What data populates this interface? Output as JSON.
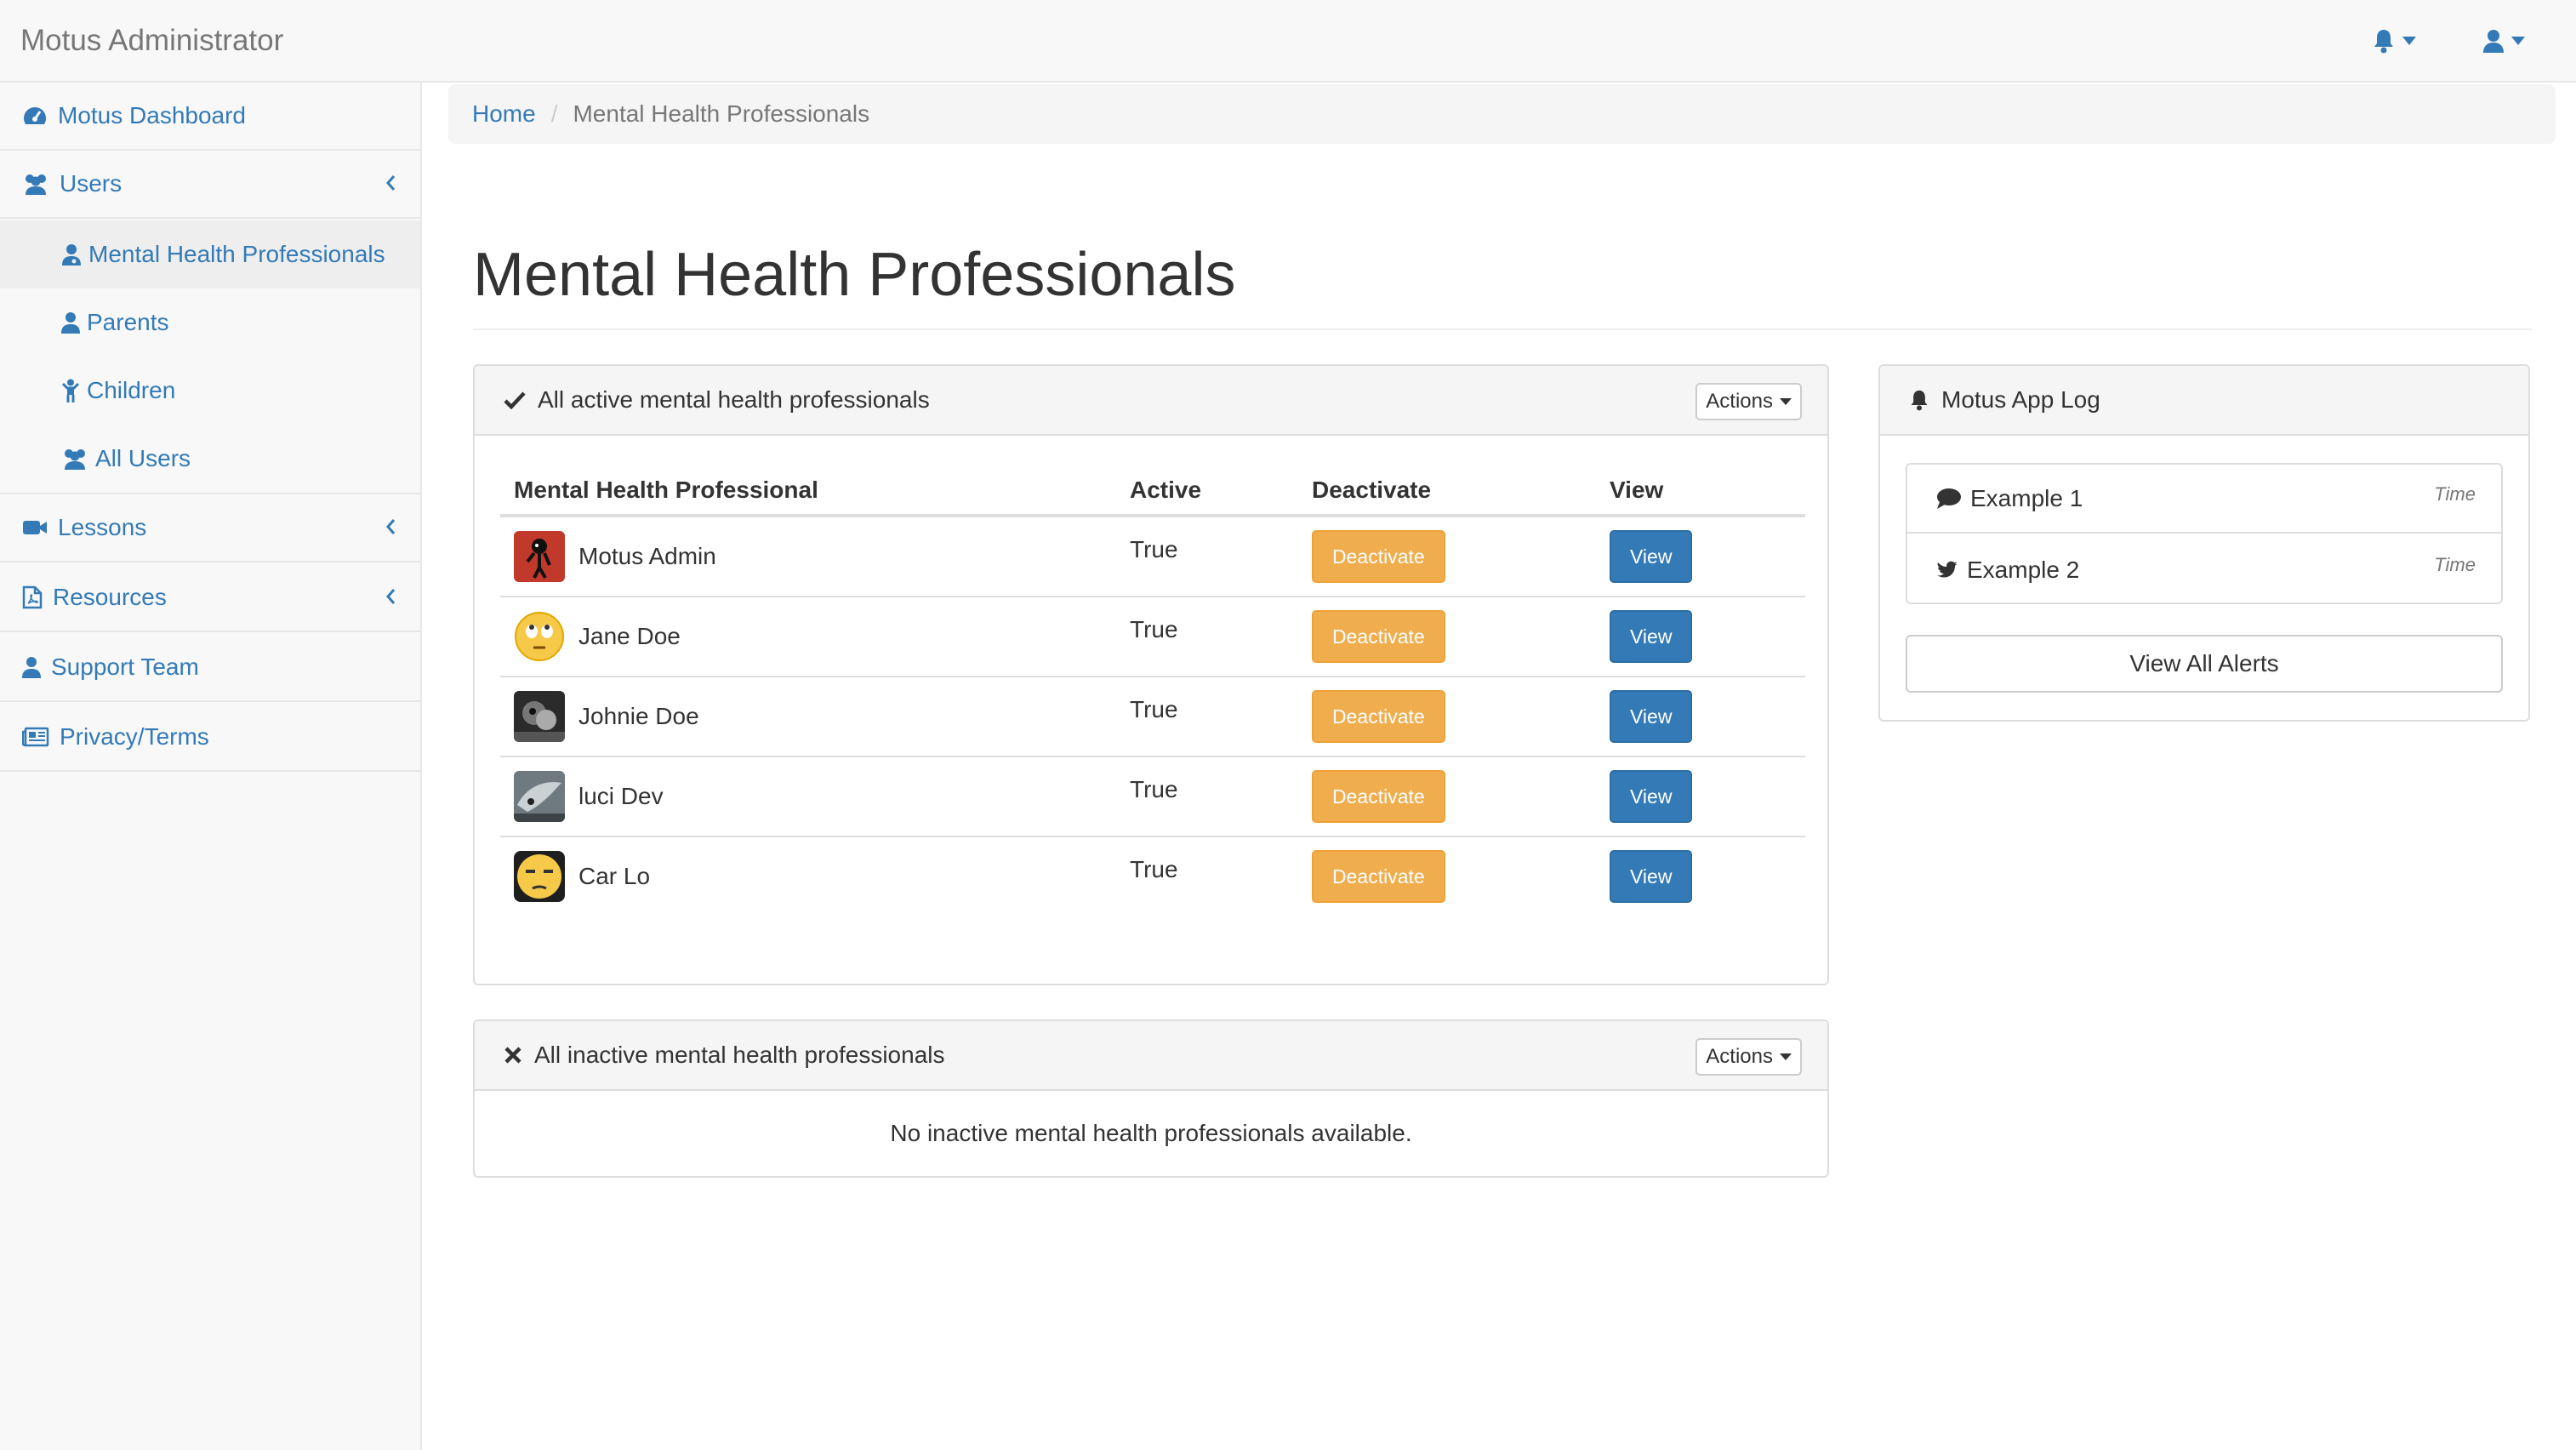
{
  "navbar": {
    "brand": "Motus Administrator",
    "icons": [
      "bell-icon",
      "user-icon"
    ]
  },
  "sidebar": {
    "items": [
      {
        "label": "Motus Dashboard",
        "icon": "dashboard-icon"
      },
      {
        "label": "Users",
        "icon": "users-icon"
      },
      {
        "label": "Lessons",
        "icon": "video-camera-icon"
      },
      {
        "label": "Resources",
        "icon": "pdf-file-icon"
      },
      {
        "label": "Support Team",
        "icon": "user-icon"
      },
      {
        "label": "Privacy/Terms",
        "icon": "newspaper-icon"
      }
    ],
    "users_sub": [
      {
        "label": "Mental Health Professionals",
        "icon": "user-md-icon",
        "active": true
      },
      {
        "label": "Parents",
        "icon": "user-icon"
      },
      {
        "label": "Children",
        "icon": "child-icon"
      },
      {
        "label": "All Users",
        "icon": "users-icon"
      }
    ]
  },
  "breadcrumb": {
    "home": "Home",
    "separator": "/",
    "current": "Mental Health Professionals"
  },
  "page_title": "Mental Health Professionals",
  "active_panel": {
    "title": "All active mental health professionals",
    "actions_label": "Actions",
    "columns": [
      "Mental Health Professional",
      "Active",
      "Deactivate",
      "View"
    ],
    "deactivate_label": "Deactivate",
    "view_label": "View",
    "rows": [
      {
        "name": "Motus Admin",
        "active": "True"
      },
      {
        "name": "Jane Doe",
        "active": "True"
      },
      {
        "name": "Johnie Doe",
        "active": "True"
      },
      {
        "name": "luci Dev",
        "active": "True"
      },
      {
        "name": "Car Lo",
        "active": "True"
      }
    ]
  },
  "inactive_panel": {
    "title": "All inactive mental health professionals",
    "actions_label": "Actions",
    "empty_message": "No inactive mental health professionals available."
  },
  "log_panel": {
    "title": "Motus App Log",
    "items": [
      {
        "label": "Example 1",
        "time": "Time",
        "icon": "comment-icon"
      },
      {
        "label": "Example 2",
        "time": "Time",
        "icon": "twitter-icon"
      }
    ],
    "view_all_label": "View All Alerts"
  },
  "colors": {
    "link": "#337ab7",
    "warning": "#f0ad4e",
    "primary": "#337ab7",
    "navbar_bg": "#f8f8f8"
  }
}
